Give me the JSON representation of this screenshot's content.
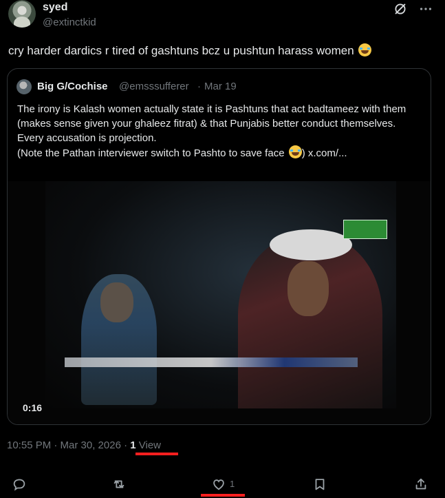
{
  "author": {
    "name": "syed",
    "handle": "@extinctkid"
  },
  "tweet": {
    "text": "cry harder dardics r tired of gashtuns bcz u pushtun harass women",
    "emoji": "joy-emoji"
  },
  "quote": {
    "author_name": "Big G/Cochise",
    "author_handle": "@emsssufferer",
    "separator": "·",
    "date": "Mar 19",
    "lines": [
      "The irony is Kalash women actually state it is Pashtuns that act badtameez with them (makes sense given your ghaleez fitrat) & that Punjabis better conduct themselves.",
      "Every accusation is projection.",
      "(Note the Pathan interviewer switch to Pashto to save face"
    ],
    "link": "x.com/..."
  },
  "video": {
    "duration": "0:16"
  },
  "meta": {
    "timestamp": "10:55 PM · Mar 30, 2026 · ",
    "views_count": "1",
    "views_label": " View"
  },
  "actions": {
    "like_count": "1",
    "icons": [
      "reply-icon",
      "retweet-icon",
      "like-icon",
      "bookmark-icon",
      "share-icon"
    ]
  },
  "colors": {
    "background": "#000000",
    "text": "#e7e9ea",
    "muted": "#71767b",
    "border": "#2f3336",
    "annotation": "#ff1f1f"
  }
}
